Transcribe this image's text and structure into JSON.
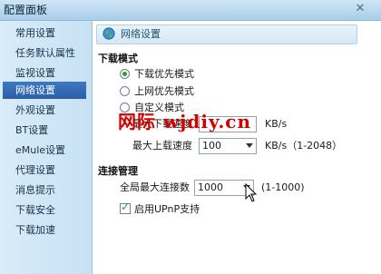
{
  "window": {
    "title": "配置面板",
    "close_icon": "close-icon"
  },
  "sidebar": {
    "items": [
      {
        "label": "常用设置",
        "active": false
      },
      {
        "label": "任务默认属性",
        "active": false
      },
      {
        "label": "监视设置",
        "active": false
      },
      {
        "label": "网络设置",
        "active": true
      },
      {
        "label": "外观设置",
        "active": false
      },
      {
        "label": "BT设置",
        "active": false
      },
      {
        "label": "eMule设置",
        "active": false
      },
      {
        "label": "代理设置",
        "active": false
      },
      {
        "label": "消息提示",
        "active": false
      },
      {
        "label": "下载安全",
        "active": false
      },
      {
        "label": "下载加速",
        "active": false
      }
    ]
  },
  "panel": {
    "title": "网络设置",
    "icon": "globe-icon"
  },
  "download_mode": {
    "section_title": "下载模式",
    "options": [
      {
        "label": "下载优先模式",
        "checked": true
      },
      {
        "label": "上网优先模式",
        "checked": false
      },
      {
        "label": "自定义模式",
        "checked": false
      }
    ],
    "max_download": {
      "label": "最大下载速度",
      "value": "",
      "unit": "KB/s"
    },
    "max_upload": {
      "label": "最大上载速度",
      "value": "100",
      "unit": "KB/s（1-2048）"
    }
  },
  "connection": {
    "section_title": "连接管理",
    "max_connections": {
      "label": "全局最大连接数",
      "value": "1000",
      "range": "(1-1000)"
    },
    "upnp": {
      "label": "启用UPnP支持",
      "checked": true
    }
  },
  "watermark": {
    "text": "网际 wjdiy.cn",
    "color": "#d40000"
  },
  "colors": {
    "sidebar_active": "#2a5fa8",
    "radio_checked": "#2a9e2a",
    "titlebar": "#a9cde9"
  }
}
